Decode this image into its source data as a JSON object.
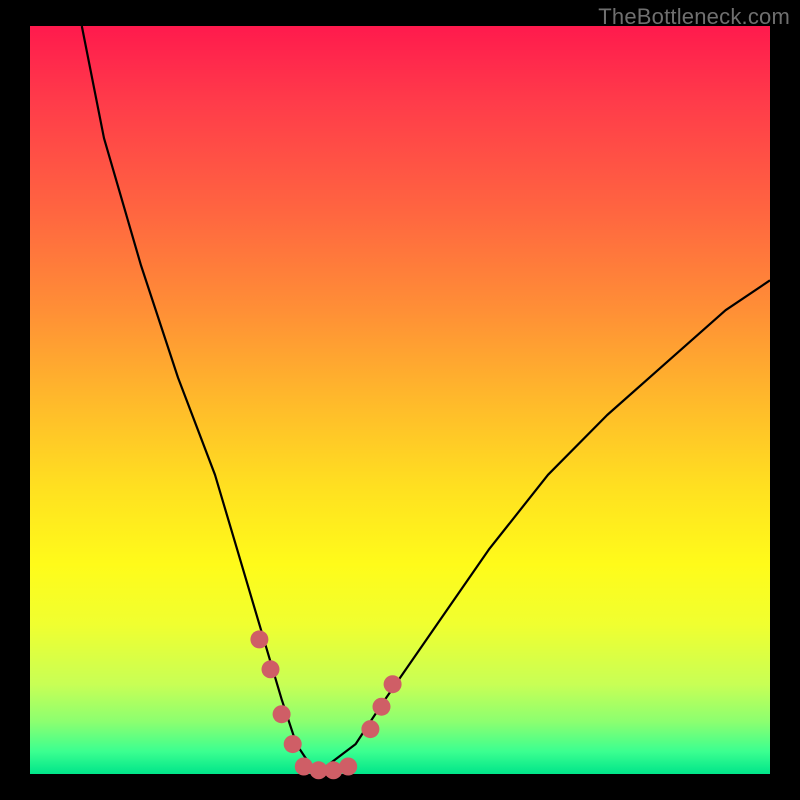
{
  "watermark": "TheBottleneck.com",
  "chart_data": {
    "type": "line",
    "title": "",
    "xlabel": "",
    "ylabel": "",
    "xlim": [
      0,
      100
    ],
    "ylim": [
      0,
      100
    ],
    "grid": false,
    "series": [
      {
        "name": "curve",
        "x": [
          7,
          10,
          15,
          20,
          25,
          28,
          31,
          34,
          36,
          38,
          40,
          44,
          48,
          55,
          62,
          70,
          78,
          86,
          94,
          100
        ],
        "values": [
          100,
          85,
          68,
          53,
          40,
          30,
          20,
          10,
          4,
          1,
          1,
          4,
          10,
          20,
          30,
          40,
          48,
          55,
          62,
          66
        ]
      }
    ],
    "markers": [
      {
        "name": "descent-marker",
        "x": 31,
        "y": 18
      },
      {
        "name": "descent-marker",
        "x": 32.5,
        "y": 14
      },
      {
        "name": "descent-marker",
        "x": 34,
        "y": 8
      },
      {
        "name": "descent-marker",
        "x": 35.5,
        "y": 4
      },
      {
        "name": "valley-marker",
        "x": 37,
        "y": 1
      },
      {
        "name": "valley-marker",
        "x": 39,
        "y": 0.5
      },
      {
        "name": "valley-marker",
        "x": 41,
        "y": 0.5
      },
      {
        "name": "valley-marker",
        "x": 43,
        "y": 1
      },
      {
        "name": "ascent-marker",
        "x": 46,
        "y": 6
      },
      {
        "name": "ascent-marker",
        "x": 47.5,
        "y": 9
      },
      {
        "name": "ascent-marker",
        "x": 49,
        "y": 12
      }
    ],
    "marker_color": "#cf5e66",
    "curve_color": "#000000",
    "gradient_stops": [
      {
        "offset": 0,
        "color": "#ff1a4d"
      },
      {
        "offset": 50,
        "color": "#ffe120"
      },
      {
        "offset": 80,
        "color": "#f0ff30"
      },
      {
        "offset": 100,
        "color": "#00e58a"
      }
    ]
  }
}
